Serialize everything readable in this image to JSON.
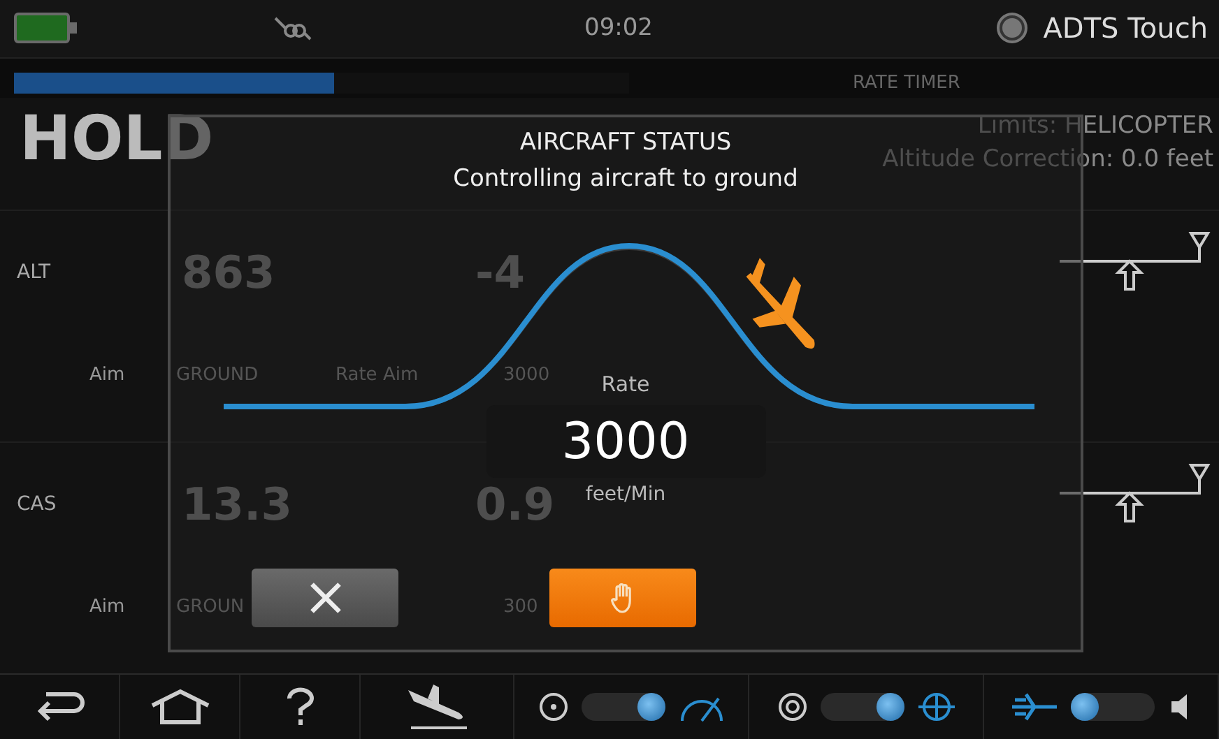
{
  "status_bar": {
    "time": "09:02",
    "app_name": "ADTS Touch"
  },
  "rate_timer": {
    "label": "RATE TIMER",
    "level": 0.52
  },
  "mode": "HOLD",
  "limits": "Limits: HELICOPTER",
  "altitude_correction": "Altitude Correction: 0.0 feet",
  "channels": [
    {
      "name": "ALT",
      "value": "863",
      "rate": "-4",
      "aim_label": "Aim",
      "aim": "GROUND",
      "rate_aim_label": "Rate Aim",
      "rate_aim": "3000"
    },
    {
      "name": "CAS",
      "value": "13.3",
      "rate": "0.9",
      "aim_label": "Aim",
      "aim": "GROUN",
      "rate_aim": "300"
    }
  ],
  "dialog": {
    "title": "AIRCRAFT STATUS",
    "message": "Controlling aircraft to ground",
    "rate_label": "Rate",
    "rate_value": "3000",
    "rate_unit": "feet/Min",
    "buttons": [
      {
        "kind": "cancel"
      },
      {
        "kind": "hold"
      }
    ]
  },
  "toolbar": {
    "toggles": [
      {
        "kind": "gauge",
        "on": true
      },
      {
        "kind": "dial",
        "on": true
      },
      {
        "kind": "jet",
        "on": false
      }
    ]
  }
}
